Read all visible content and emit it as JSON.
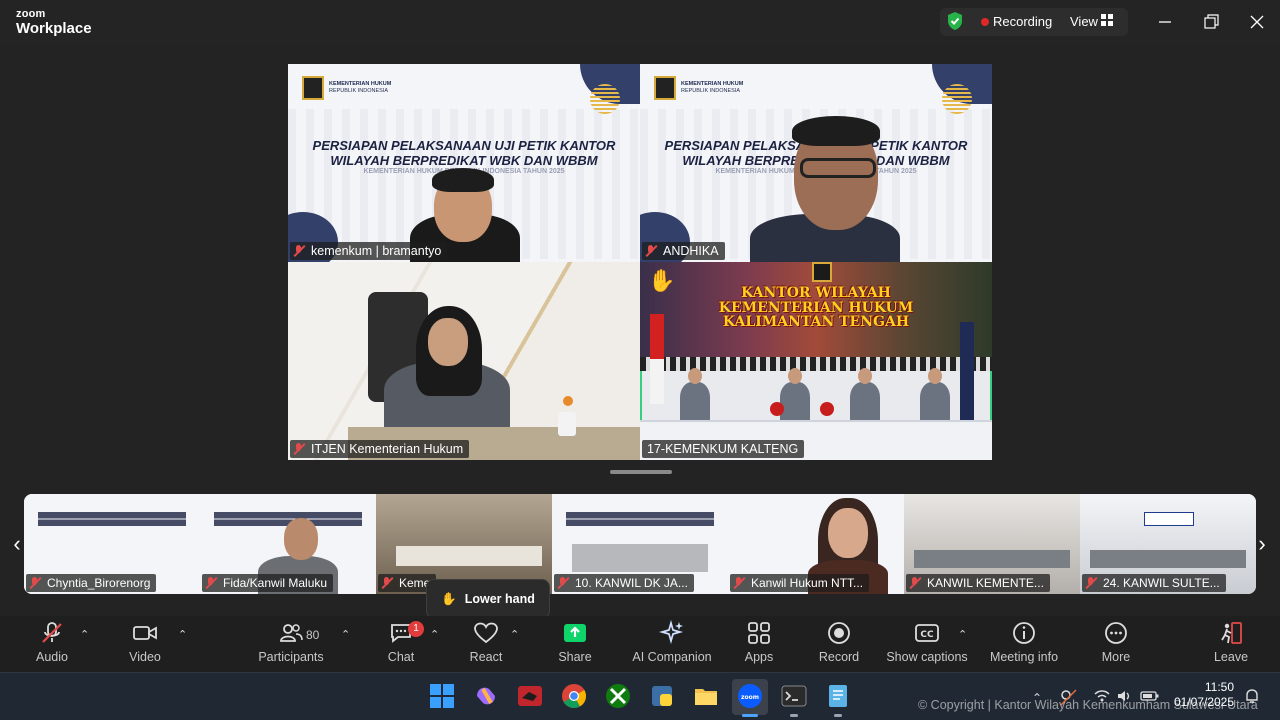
{
  "app": {
    "brand_top": "zoom",
    "brand_bottom": "Workplace"
  },
  "titlebar": {
    "recording_label": "Recording",
    "view_label": "View"
  },
  "slide": {
    "ministry_line1": "KEMENTERIAN HUKUM",
    "ministry_line2": "REPUBLIK INDONESIA",
    "title_line1": "PERSIAPAN PELAKSANAAN UJI PETIK KANTOR",
    "title_line2": "WILAYAH BERPREDIKAT WBK DAN WBBM",
    "subtitle": "KEMENTERIAN HUKUM REPUBLIK INDONESIA TAHUN 2025"
  },
  "main_tiles": [
    {
      "name": "kemenkum | bramantyo"
    },
    {
      "name": "ANDHIKA"
    },
    {
      "name": "ITJEN Kementerian Hukum"
    },
    {
      "name": "17-KEMENKUM KALTENG",
      "banner_line1": "KANTOR WILAYAH",
      "banner_line2": "KEMENTERIAN HUKUM",
      "banner_line3": "KALIMANTAN TENGAH",
      "hand": "✋"
    }
  ],
  "strip_tiles": [
    {
      "name": "Chyntia_Birorenorg"
    },
    {
      "name": "Fida/Kanwil Maluku"
    },
    {
      "name": "Keme"
    },
    {
      "name": "10. KANWIL DK JA..."
    },
    {
      "name": "Kanwil Hukum NTT..."
    },
    {
      "name": "KANWIL KEMENTE..."
    },
    {
      "name": "24. KANWIL SULTE..."
    }
  ],
  "lower_hand": {
    "icon": "✋",
    "label": "Lower hand"
  },
  "toolbar": {
    "audio": "Audio",
    "video": "Video",
    "participants": "Participants",
    "participants_count": "80",
    "chat": "Chat",
    "chat_badge": "1",
    "react": "React",
    "share": "Share",
    "ai_companion": "AI Companion",
    "apps": "Apps",
    "record": "Record",
    "show_captions": "Show captions",
    "meeting_info": "Meeting info",
    "more": "More",
    "leave": "Leave"
  },
  "taskbar": {
    "time": "11:50",
    "date": "01/07/2025"
  },
  "copyright": "© Copyright | Kantor Wilayah Kemenkumham Sulawesi Utara",
  "colors": {
    "accent_green": "#35d07f",
    "record_red": "#e02828",
    "share_green": "#0fd46a"
  }
}
